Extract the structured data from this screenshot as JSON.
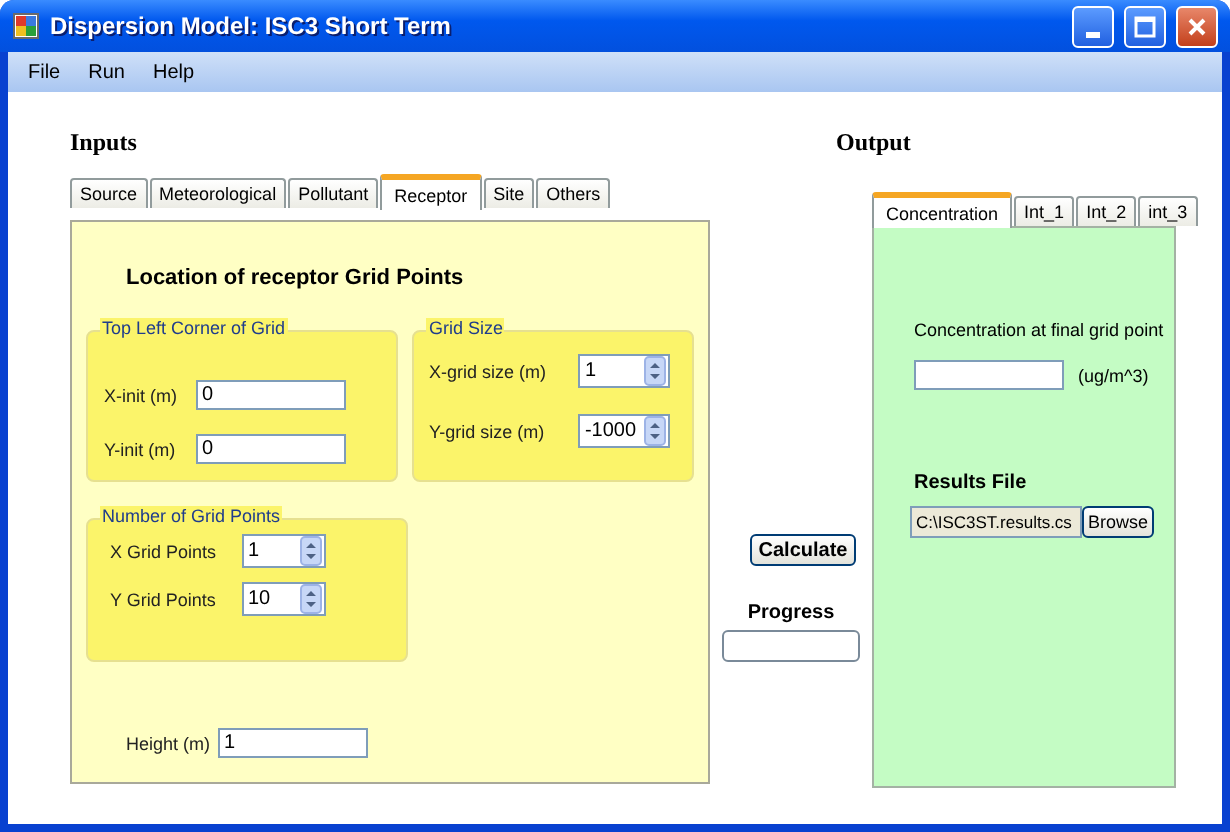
{
  "window": {
    "title": "Dispersion Model: ISC3 Short Term"
  },
  "menu": [
    "File",
    "Run",
    "Help"
  ],
  "inputs": {
    "heading": "Inputs",
    "tabs": [
      {
        "label": "Source",
        "selected": false
      },
      {
        "label": "Meteorological",
        "selected": false
      },
      {
        "label": "Pollutant",
        "selected": false
      },
      {
        "label": "Receptor",
        "selected": true
      },
      {
        "label": "Site",
        "selected": false
      },
      {
        "label": "Others",
        "selected": false
      }
    ],
    "panel_title": "Location of receptor Grid Points",
    "groups": [
      {
        "title": "Top  Left Corner of Grid",
        "fields": [
          {
            "kind": "text",
            "label": "X-init (m)",
            "value": "0"
          },
          {
            "kind": "text",
            "label": "Y-init (m)",
            "value": "0"
          }
        ]
      },
      {
        "title": "Grid Size",
        "fields": [
          {
            "kind": "spin",
            "label": "X-grid size (m)",
            "value": "1"
          },
          {
            "kind": "spin",
            "label": "Y-grid size (m)",
            "value": "-1000"
          }
        ]
      },
      {
        "title": "Number of Grid Points",
        "fields": [
          {
            "kind": "spin",
            "label": "X Grid Points",
            "value": "1"
          },
          {
            "kind": "spin",
            "label": "Y Grid Points",
            "value": "10"
          }
        ]
      }
    ],
    "height": {
      "label": "Height (m)",
      "value": "1"
    }
  },
  "calculate_button": "Calculate",
  "progress": {
    "label": "Progress",
    "level": 0
  },
  "output": {
    "heading": "Output",
    "tabs": [
      {
        "label": "Concentration",
        "selected": true
      },
      {
        "label": "Int_1",
        "selected": false
      },
      {
        "label": "Int_2",
        "selected": false
      },
      {
        "label": "int_3",
        "selected": false
      }
    ],
    "concentration_label": "Concentration at final grid point",
    "unit": "(ug/m^3)",
    "results_label": "Results File",
    "results_path": "C:\\ISC3ST.results.cs",
    "browse_button": "Browse"
  }
}
